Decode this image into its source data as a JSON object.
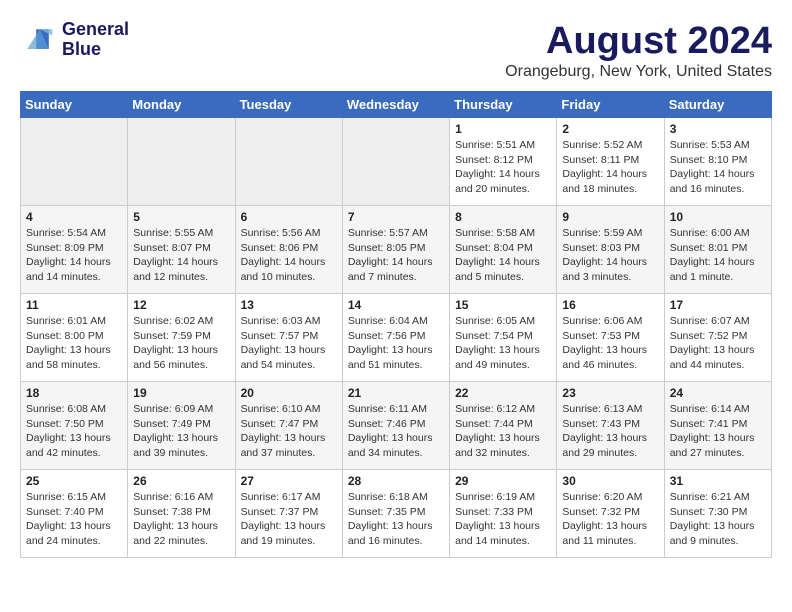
{
  "header": {
    "logo_line1": "General",
    "logo_line2": "Blue",
    "month": "August 2024",
    "location": "Orangeburg, New York, United States"
  },
  "days_of_week": [
    "Sunday",
    "Monday",
    "Tuesday",
    "Wednesday",
    "Thursday",
    "Friday",
    "Saturday"
  ],
  "weeks": [
    [
      {
        "day": "",
        "empty": true
      },
      {
        "day": "",
        "empty": true
      },
      {
        "day": "",
        "empty": true
      },
      {
        "day": "",
        "empty": true
      },
      {
        "day": "1",
        "sunrise": "5:51 AM",
        "sunset": "8:12 PM",
        "daylight": "14 hours and 20 minutes."
      },
      {
        "day": "2",
        "sunrise": "5:52 AM",
        "sunset": "8:11 PM",
        "daylight": "14 hours and 18 minutes."
      },
      {
        "day": "3",
        "sunrise": "5:53 AM",
        "sunset": "8:10 PM",
        "daylight": "14 hours and 16 minutes."
      }
    ],
    [
      {
        "day": "4",
        "sunrise": "5:54 AM",
        "sunset": "8:09 PM",
        "daylight": "14 hours and 14 minutes."
      },
      {
        "day": "5",
        "sunrise": "5:55 AM",
        "sunset": "8:07 PM",
        "daylight": "14 hours and 12 minutes."
      },
      {
        "day": "6",
        "sunrise": "5:56 AM",
        "sunset": "8:06 PM",
        "daylight": "14 hours and 10 minutes."
      },
      {
        "day": "7",
        "sunrise": "5:57 AM",
        "sunset": "8:05 PM",
        "daylight": "14 hours and 7 minutes."
      },
      {
        "day": "8",
        "sunrise": "5:58 AM",
        "sunset": "8:04 PM",
        "daylight": "14 hours and 5 minutes."
      },
      {
        "day": "9",
        "sunrise": "5:59 AM",
        "sunset": "8:03 PM",
        "daylight": "14 hours and 3 minutes."
      },
      {
        "day": "10",
        "sunrise": "6:00 AM",
        "sunset": "8:01 PM",
        "daylight": "14 hours and 1 minute."
      }
    ],
    [
      {
        "day": "11",
        "sunrise": "6:01 AM",
        "sunset": "8:00 PM",
        "daylight": "13 hours and 58 minutes."
      },
      {
        "day": "12",
        "sunrise": "6:02 AM",
        "sunset": "7:59 PM",
        "daylight": "13 hours and 56 minutes."
      },
      {
        "day": "13",
        "sunrise": "6:03 AM",
        "sunset": "7:57 PM",
        "daylight": "13 hours and 54 minutes."
      },
      {
        "day": "14",
        "sunrise": "6:04 AM",
        "sunset": "7:56 PM",
        "daylight": "13 hours and 51 minutes."
      },
      {
        "day": "15",
        "sunrise": "6:05 AM",
        "sunset": "7:54 PM",
        "daylight": "13 hours and 49 minutes."
      },
      {
        "day": "16",
        "sunrise": "6:06 AM",
        "sunset": "7:53 PM",
        "daylight": "13 hours and 46 minutes."
      },
      {
        "day": "17",
        "sunrise": "6:07 AM",
        "sunset": "7:52 PM",
        "daylight": "13 hours and 44 minutes."
      }
    ],
    [
      {
        "day": "18",
        "sunrise": "6:08 AM",
        "sunset": "7:50 PM",
        "daylight": "13 hours and 42 minutes."
      },
      {
        "day": "19",
        "sunrise": "6:09 AM",
        "sunset": "7:49 PM",
        "daylight": "13 hours and 39 minutes."
      },
      {
        "day": "20",
        "sunrise": "6:10 AM",
        "sunset": "7:47 PM",
        "daylight": "13 hours and 37 minutes."
      },
      {
        "day": "21",
        "sunrise": "6:11 AM",
        "sunset": "7:46 PM",
        "daylight": "13 hours and 34 minutes."
      },
      {
        "day": "22",
        "sunrise": "6:12 AM",
        "sunset": "7:44 PM",
        "daylight": "13 hours and 32 minutes."
      },
      {
        "day": "23",
        "sunrise": "6:13 AM",
        "sunset": "7:43 PM",
        "daylight": "13 hours and 29 minutes."
      },
      {
        "day": "24",
        "sunrise": "6:14 AM",
        "sunset": "7:41 PM",
        "daylight": "13 hours and 27 minutes."
      }
    ],
    [
      {
        "day": "25",
        "sunrise": "6:15 AM",
        "sunset": "7:40 PM",
        "daylight": "13 hours and 24 minutes."
      },
      {
        "day": "26",
        "sunrise": "6:16 AM",
        "sunset": "7:38 PM",
        "daylight": "13 hours and 22 minutes."
      },
      {
        "day": "27",
        "sunrise": "6:17 AM",
        "sunset": "7:37 PM",
        "daylight": "13 hours and 19 minutes."
      },
      {
        "day": "28",
        "sunrise": "6:18 AM",
        "sunset": "7:35 PM",
        "daylight": "13 hours and 16 minutes."
      },
      {
        "day": "29",
        "sunrise": "6:19 AM",
        "sunset": "7:33 PM",
        "daylight": "13 hours and 14 minutes."
      },
      {
        "day": "30",
        "sunrise": "6:20 AM",
        "sunset": "7:32 PM",
        "daylight": "13 hours and 11 minutes."
      },
      {
        "day": "31",
        "sunrise": "6:21 AM",
        "sunset": "7:30 PM",
        "daylight": "13 hours and 9 minutes."
      }
    ]
  ]
}
